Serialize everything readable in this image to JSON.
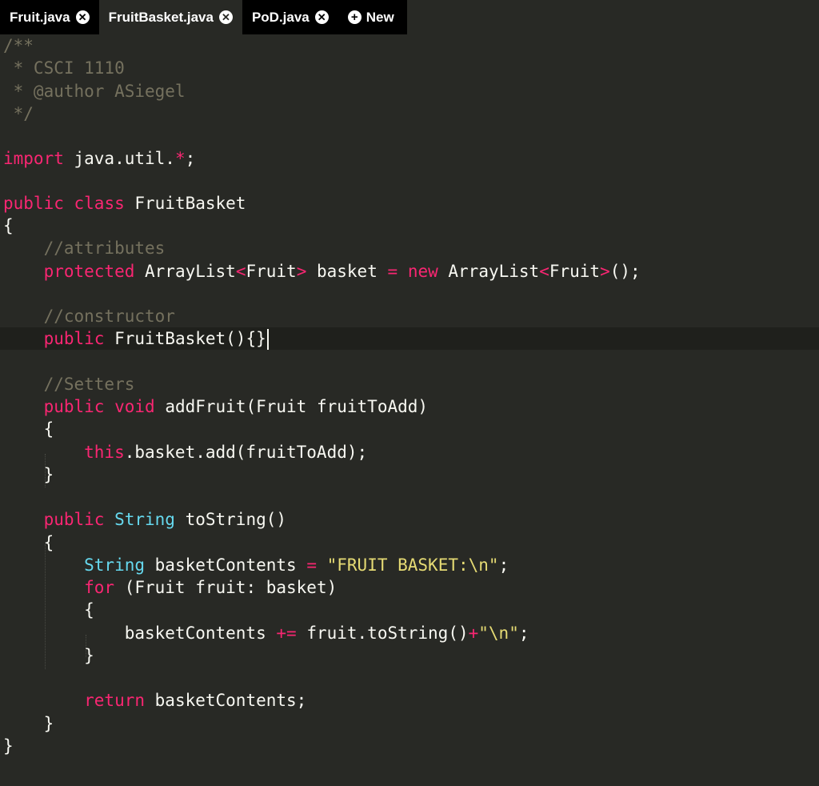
{
  "tabs": [
    {
      "label": "Fruit.java",
      "active": false
    },
    {
      "label": "FruitBasket.java",
      "active": true
    },
    {
      "label": "PoD.java",
      "active": false
    }
  ],
  "new_tab_label": "New",
  "icons": {
    "close": "close-icon",
    "new": "plus-icon"
  },
  "colors": {
    "background": "#282925",
    "comment": "#75715e",
    "keyword": "#f92672",
    "type": "#66d9ef",
    "string": "#e6db74",
    "text": "#f8f8f2"
  },
  "code": {
    "l1": "/**",
    "l2": " * CSCI 1110",
    "l3": " * @author ASiegel",
    "l4": " */",
    "import_kw": "import",
    "import_pkg": " java.util.",
    "import_star": "*",
    "import_end": ";",
    "class_public": "public",
    "class_kw": "class",
    "class_name": " FruitBasket",
    "brace_open": "{",
    "c_attributes": "    //attributes",
    "attr_protected": "    protected",
    "attr_type": " ArrayList",
    "attr_lt1": "<",
    "attr_generic1": "Fruit",
    "attr_gt1": ">",
    "attr_name": " basket ",
    "attr_eq": "=",
    "attr_new": "new",
    "attr_type2": " ArrayList",
    "attr_lt2": "<",
    "attr_generic2": "Fruit",
    "attr_gt2": ">",
    "attr_end": "();",
    "c_constructor": "    //constructor",
    "ctor_public": "    public",
    "ctor_rest": " FruitBasket(){}",
    "c_setters": "    //Setters",
    "add_public": "    public",
    "add_void": "void",
    "add_rest": " addFruit(Fruit fruitToAdd)",
    "brace_open_1": "    {",
    "add_this": "        this",
    "add_body": ".basket.add(fruitToAdd);",
    "brace_close_1": "    }",
    "ts_public": "    public",
    "ts_string": "String",
    "ts_rest": " toString()",
    "brace_open_2": "    {",
    "ts_string2": "        String",
    "ts_var": " basketContents ",
    "ts_eq": "=",
    "ts_str": "\"FRUIT BASKET:\\n\"",
    "ts_semi": ";",
    "for_kw": "        for",
    "for_rest": " (Fruit fruit: basket)",
    "brace_open_3": "        {",
    "bc_var": "            basketContents ",
    "bc_op": "+=",
    "bc_call": " fruit.toString()",
    "bc_plus": "+",
    "bc_str": "\"\\n\"",
    "bc_semi": ";",
    "brace_close_3": "        }",
    "ret_kw": "        return",
    "ret_rest": " basketContents;",
    "brace_close_2": "    }",
    "brace_close_class": "}"
  }
}
